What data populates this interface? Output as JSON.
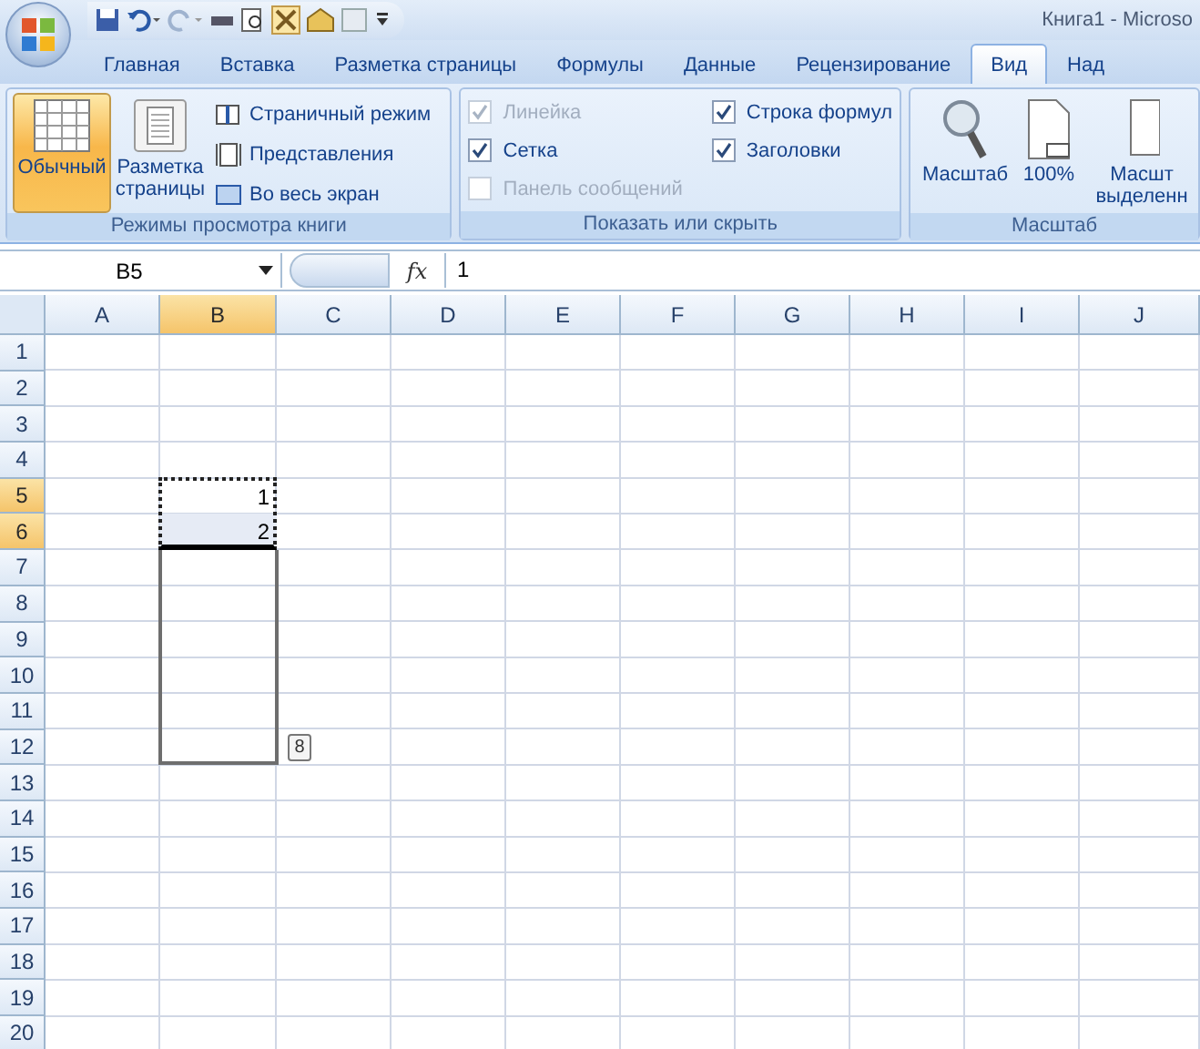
{
  "window": {
    "title": "Книга1 - Microso"
  },
  "tabs": [
    {
      "label": "Главная",
      "selected": false
    },
    {
      "label": "Вставка",
      "selected": false
    },
    {
      "label": "Разметка страницы",
      "selected": false
    },
    {
      "label": "Формулы",
      "selected": false
    },
    {
      "label": "Данные",
      "selected": false
    },
    {
      "label": "Рецензирование",
      "selected": false
    },
    {
      "label": "Вид",
      "selected": true
    },
    {
      "label": "Над",
      "selected": false
    }
  ],
  "ribbon": {
    "view_modes": {
      "title": "Режимы просмотра книги",
      "large_buttons": [
        {
          "label": "Обычный",
          "selected": true
        },
        {
          "label": "Разметка\nстраницы",
          "selected": false
        }
      ],
      "small_buttons": [
        {
          "label": "Страничный режим"
        },
        {
          "label": "Представления"
        },
        {
          "label": "Во весь экран"
        }
      ]
    },
    "show_hide": {
      "title": "Показать или скрыть",
      "checkboxes": [
        {
          "label": "Линейка",
          "checked": true,
          "disabled": true
        },
        {
          "label": "Сетка",
          "checked": true,
          "disabled": false
        },
        {
          "label": "Панель сообщений",
          "checked": false,
          "disabled": true
        },
        {
          "label": "Строка формул",
          "checked": true,
          "disabled": false
        },
        {
          "label": "Заголовки",
          "checked": true,
          "disabled": false
        }
      ]
    },
    "zoom": {
      "title": "Масштаб",
      "buttons": [
        {
          "label": "Масштаб"
        },
        {
          "label": "100%"
        },
        {
          "label": "Масшт\nвыделенн"
        }
      ]
    }
  },
  "formula_bar": {
    "name_box": "B5",
    "function_label": "fx",
    "formula": "1"
  },
  "sheet": {
    "columns": [
      {
        "label": "A",
        "selected": false
      },
      {
        "label": "B",
        "selected": true
      },
      {
        "label": "C",
        "selected": false
      },
      {
        "label": "D",
        "selected": false
      },
      {
        "label": "E",
        "selected": false
      },
      {
        "label": "F",
        "selected": false
      },
      {
        "label": "G",
        "selected": false
      },
      {
        "label": "H",
        "selected": false
      },
      {
        "label": "I",
        "selected": false
      },
      {
        "label": "J",
        "selected": false
      }
    ],
    "rows": [
      {
        "label": "1",
        "selected": false,
        "fill_preview": false
      },
      {
        "label": "2",
        "selected": false,
        "fill_preview": false
      },
      {
        "label": "3",
        "selected": false,
        "fill_preview": false
      },
      {
        "label": "4",
        "selected": false,
        "fill_preview": false
      },
      {
        "label": "5",
        "selected": true,
        "fill_preview": false,
        "column_b": "1"
      },
      {
        "label": "6",
        "selected": true,
        "fill_preview": false,
        "column_b": "2"
      },
      {
        "label": "7",
        "selected": false,
        "fill_preview": true
      },
      {
        "label": "8",
        "selected": false,
        "fill_preview": true
      },
      {
        "label": "9",
        "selected": false,
        "fill_preview": true
      },
      {
        "label": "10",
        "selected": false,
        "fill_preview": true
      },
      {
        "label": "11",
        "selected": false,
        "fill_preview": true
      },
      {
        "label": "12",
        "selected": false,
        "fill_preview": true
      },
      {
        "label": "13",
        "selected": false,
        "fill_preview": false
      },
      {
        "label": "14",
        "selected": false,
        "fill_preview": false
      },
      {
        "label": "15",
        "selected": false,
        "fill_preview": false
      },
      {
        "label": "16",
        "selected": false,
        "fill_preview": false
      },
      {
        "label": "17",
        "selected": false,
        "fill_preview": false
      },
      {
        "label": "18",
        "selected": false,
        "fill_preview": false
      },
      {
        "label": "19",
        "selected": false,
        "fill_preview": false
      },
      {
        "label": "20",
        "selected": false,
        "fill_preview": false
      }
    ],
    "fill_tip": "8"
  }
}
